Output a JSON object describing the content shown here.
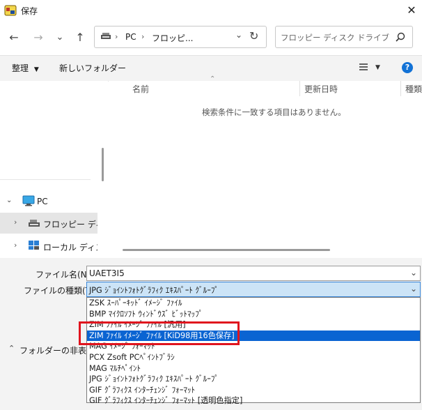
{
  "window": {
    "title": "保存",
    "close_glyph": "✕"
  },
  "nav": {
    "back_glyph": "←",
    "forward_glyph": "→",
    "recent_glyph": "⌄",
    "up_glyph": "↑",
    "address_parts": [
      "PC",
      "フロッピ..."
    ],
    "address_sep": "›",
    "refresh_glyph": "↻",
    "address_dropdown_glyph": "⌄",
    "search_placeholder": "フロッピー ディスク ドライブ (A:)..."
  },
  "toolbar": {
    "organize_label": "整理",
    "new_folder_label": "新しいフォルダー",
    "help_glyph": "?"
  },
  "navpane": {
    "pc_label": "PC",
    "items": [
      {
        "label": "フロッピー ディスク"
      },
      {
        "label": "ローカル ディスク"
      }
    ]
  },
  "columns": {
    "name": "名前",
    "date": "更新日時",
    "type": "種類"
  },
  "empty_message": "検索条件に一致する項目はありません。",
  "form": {
    "filename_label": "ファイル名(N):",
    "filename_value": "UAET3I5",
    "filetype_label": "ファイルの種類(T):",
    "filetype_value": "JPG ｼﾞｮｲﾝﾄﾌｫﾄｸﾞﾗﾌｨｸ ｴｷｽﾊﾟｰﾄ ｸﾞﾙｰﾌﾟ"
  },
  "filetype_options": [
    "ZSK ｽｰﾊﾟｰｷｯﾄﾞ ｲﾒｰｼﾞ ﾌｧｲﾙ",
    "BMP ﾏｲｸﾛｿﾌﾄ ｳｨﾝﾄﾞｳｽﾞ ﾋﾞｯﾄﾏｯﾌﾟ",
    "ZIM ﾌｧｲﾙ ｲﾒｰｼﾞ ﾌｧｲﾙ [汎用]",
    "ZIM ﾌｧｲﾙ ｲﾒｰｼﾞ ﾌｧｲﾙ [KiD98用16色保存]",
    "MAG ｲﾒｰｼﾞ ﾌｫｰﾏｯﾄ",
    "PCX Zsoft PCﾍﾟｲﾝﾄﾌﾞﾗｼ",
    "MAG ﾏﾙﾁﾍﾟｲﾝﾄ",
    "JPG ｼﾞｮｲﾝﾄﾌｫﾄｸﾞﾗﾌｨｸ ｴｷｽﾊﾟｰﾄ ｸﾞﾙｰﾌﾟ",
    "GIF ｸﾞﾗﾌｨｸｽ ｲﾝﾀｰﾁｪﾝｼﾞ ﾌｫｰﾏｯﾄ",
    "GIF ｸﾞﾗﾌｨｸｽ ｲﾝﾀｰﾁｪﾝｼﾞ ﾌｫｰﾏｯﾄ [透明色指定]"
  ],
  "selected_option_index": 3,
  "hide_folders_label": "フォルダーの非表示",
  "colors": {
    "accent": "#0a64d2",
    "highlight_box": "#e0141e",
    "select_bg": "#cce4f7"
  }
}
